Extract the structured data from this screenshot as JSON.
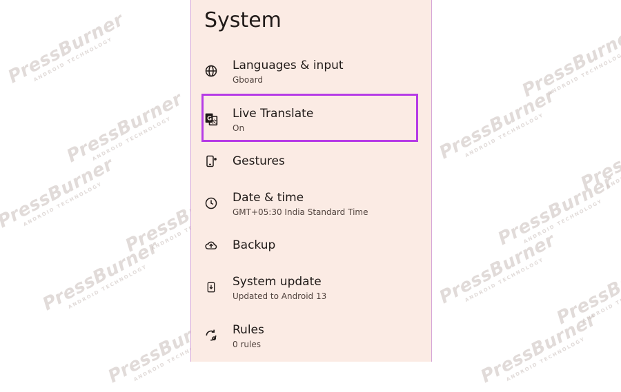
{
  "watermark": {
    "brand": "PressBurner",
    "tagline": "ANDROID TECHNOLOGY"
  },
  "page": {
    "title": "System"
  },
  "items": [
    {
      "title": "Languages & input",
      "subtitle": "Gboard",
      "icon": "globe-icon"
    },
    {
      "title": "Live Translate",
      "subtitle": "On",
      "icon": "translate-icon"
    },
    {
      "title": "Gestures",
      "subtitle": "",
      "icon": "gestures-phone-icon"
    },
    {
      "title": "Date & time",
      "subtitle": "GMT+05:30 India Standard Time",
      "icon": "clock-icon"
    },
    {
      "title": "Backup",
      "subtitle": "",
      "icon": "cloud-upload-icon"
    },
    {
      "title": "System update",
      "subtitle": "Updated to Android 13",
      "icon": "system-update-icon"
    },
    {
      "title": "Rules",
      "subtitle": "0 rules",
      "icon": "rules-icon"
    }
  ],
  "colors": {
    "panel": "#fbebe4",
    "highlight": "#b63be6",
    "text": "#201a18"
  }
}
